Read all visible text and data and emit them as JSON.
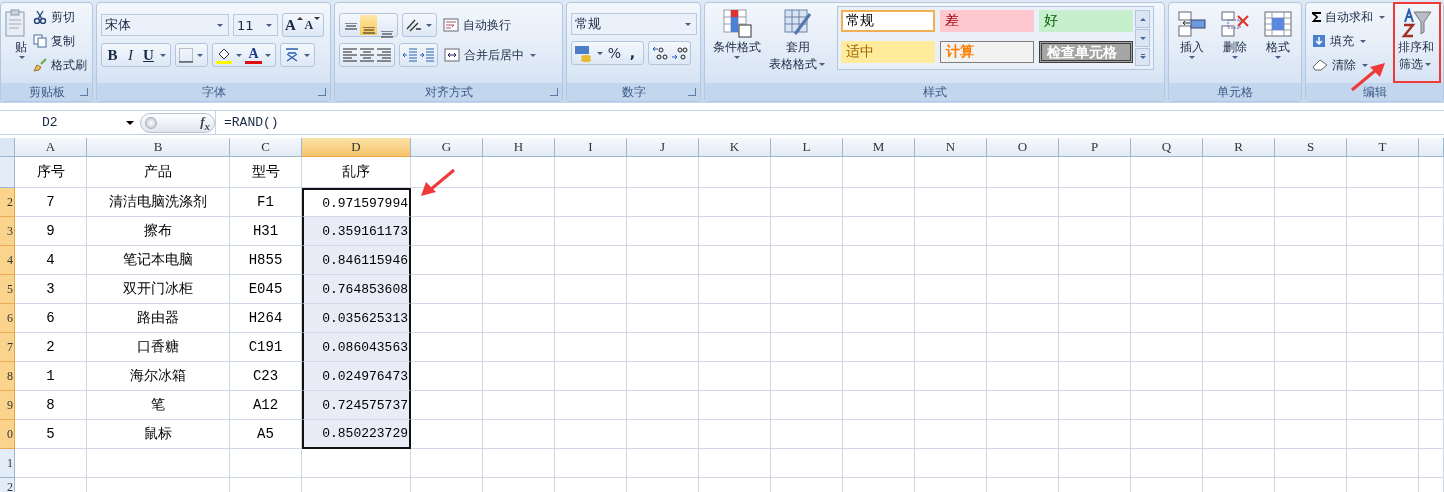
{
  "ribbon": {
    "clipboard": {
      "label": "剪贴板",
      "paste": "贴",
      "cut": "剪切",
      "copy": "复制",
      "format_painter": "格式刷"
    },
    "font": {
      "label": "字体",
      "font_name": "宋体",
      "font_size": "11",
      "grow": "A",
      "shrink": "A",
      "bold": "B",
      "italic": "I",
      "underline": "U",
      "font_color": "A"
    },
    "alignment": {
      "label": "对齐方式",
      "vertical": [
        {
          "kind": "top",
          "selected": false
        },
        {
          "kind": "middle",
          "selected": true
        },
        {
          "kind": "bottom",
          "selected": false
        }
      ],
      "wrap_text": "自动换行",
      "merge_center": "合并后居中"
    },
    "number": {
      "label": "数字",
      "format": "常规",
      "percent": "%",
      "comma": ","
    },
    "styles": {
      "label": "样式",
      "conditional_format": "条件格式",
      "table_format_1": "套用",
      "table_format_2": "表格格式",
      "gallery": [
        {
          "text": "常规",
          "kind": "normal",
          "selected": true
        },
        {
          "text": "差",
          "kind": "bad",
          "selected": false
        },
        {
          "text": "好",
          "kind": "good",
          "selected": false
        },
        {
          "text": "适中",
          "kind": "neutral",
          "selected": false
        },
        {
          "text": "计算",
          "kind": "calculation",
          "selected": false
        },
        {
          "text": "检查单元格",
          "kind": "check",
          "selected": false
        }
      ]
    },
    "cells": {
      "label": "单元格",
      "insert": "插入",
      "delete": "删除",
      "format": "格式"
    },
    "editing": {
      "label": "编辑",
      "autosum": "自动求和",
      "fill": "填充",
      "clear": "清除",
      "sort_1": "排序和",
      "sort_2": "筛选"
    }
  },
  "formula_bar": {
    "name_box": "D2",
    "function_label": "f$_{x}$",
    "formula": "=RAND()"
  },
  "sheet": {
    "columns": [
      {
        "label": "A",
        "selected": false,
        "kind": "text"
      },
      {
        "label": "B",
        "selected": false,
        "kind": "text"
      },
      {
        "label": "C",
        "selected": false,
        "kind": "text"
      },
      {
        "label": "D",
        "selected": true,
        "kind": "numeric"
      },
      {
        "label": "G",
        "selected": false,
        "kind": "text"
      },
      {
        "label": "H",
        "selected": false,
        "kind": "text"
      },
      {
        "label": "I",
        "selected": false,
        "kind": "text"
      },
      {
        "label": "J",
        "selected": false,
        "kind": "text"
      },
      {
        "label": "K",
        "selected": false,
        "kind": "text"
      },
      {
        "label": "L",
        "selected": false,
        "kind": "text"
      },
      {
        "label": "M",
        "selected": false,
        "kind": "text"
      },
      {
        "label": "N",
        "selected": false,
        "kind": "text"
      },
      {
        "label": "O",
        "selected": false,
        "kind": "text"
      },
      {
        "label": "P",
        "selected": false,
        "kind": "text"
      },
      {
        "label": "Q",
        "selected": false,
        "kind": "text"
      },
      {
        "label": "R",
        "selected": false,
        "kind": "text"
      },
      {
        "label": "S",
        "selected": false,
        "kind": "text"
      },
      {
        "label": "T",
        "selected": false,
        "kind": "text"
      }
    ],
    "rows": [
      {
        "header": "",
        "kind": "header",
        "selected": false,
        "cells": [
          "序号",
          "产品",
          "型号",
          "乱序"
        ]
      },
      {
        "header": "2",
        "kind": "data",
        "selected": true,
        "active": true,
        "cells": [
          "7",
          "清洁电脑洗涤剂",
          "F1",
          "0.971597994"
        ]
      },
      {
        "header": "3",
        "kind": "data",
        "selected": true,
        "active": false,
        "cells": [
          "9",
          "擦布",
          "H31",
          "0.359161173"
        ]
      },
      {
        "header": "4",
        "kind": "data",
        "selected": true,
        "active": false,
        "cells": [
          "4",
          "笔记本电脑",
          "H855",
          "0.846115946"
        ]
      },
      {
        "header": "5",
        "kind": "data",
        "selected": true,
        "active": false,
        "cells": [
          "3",
          "双开门冰柜",
          "E045",
          "0.764853608"
        ]
      },
      {
        "header": "6",
        "kind": "data",
        "selected": true,
        "active": false,
        "cells": [
          "6",
          "路由器",
          "H264",
          "0.035625313"
        ]
      },
      {
        "header": "7",
        "kind": "data",
        "selected": true,
        "active": false,
        "cells": [
          "2",
          "口香糖",
          "C191",
          "0.086043563"
        ]
      },
      {
        "header": "8",
        "kind": "data",
        "selected": true,
        "active": false,
        "cells": [
          "1",
          "海尔冰箱",
          "C23",
          "0.024976473"
        ]
      },
      {
        "header": "9",
        "kind": "data",
        "selected": true,
        "active": false,
        "cells": [
          "8",
          "笔",
          "A12",
          "0.724575737"
        ]
      },
      {
        "header": "0",
        "kind": "data",
        "selected": true,
        "active": false,
        "cells": [
          "5",
          "鼠标",
          "A5",
          "0.850223729"
        ]
      },
      {
        "header": "1",
        "kind": "empty",
        "selected": false,
        "cells": []
      },
      {
        "header": "2",
        "kind": "empty",
        "selected": false,
        "cells": []
      }
    ]
  }
}
